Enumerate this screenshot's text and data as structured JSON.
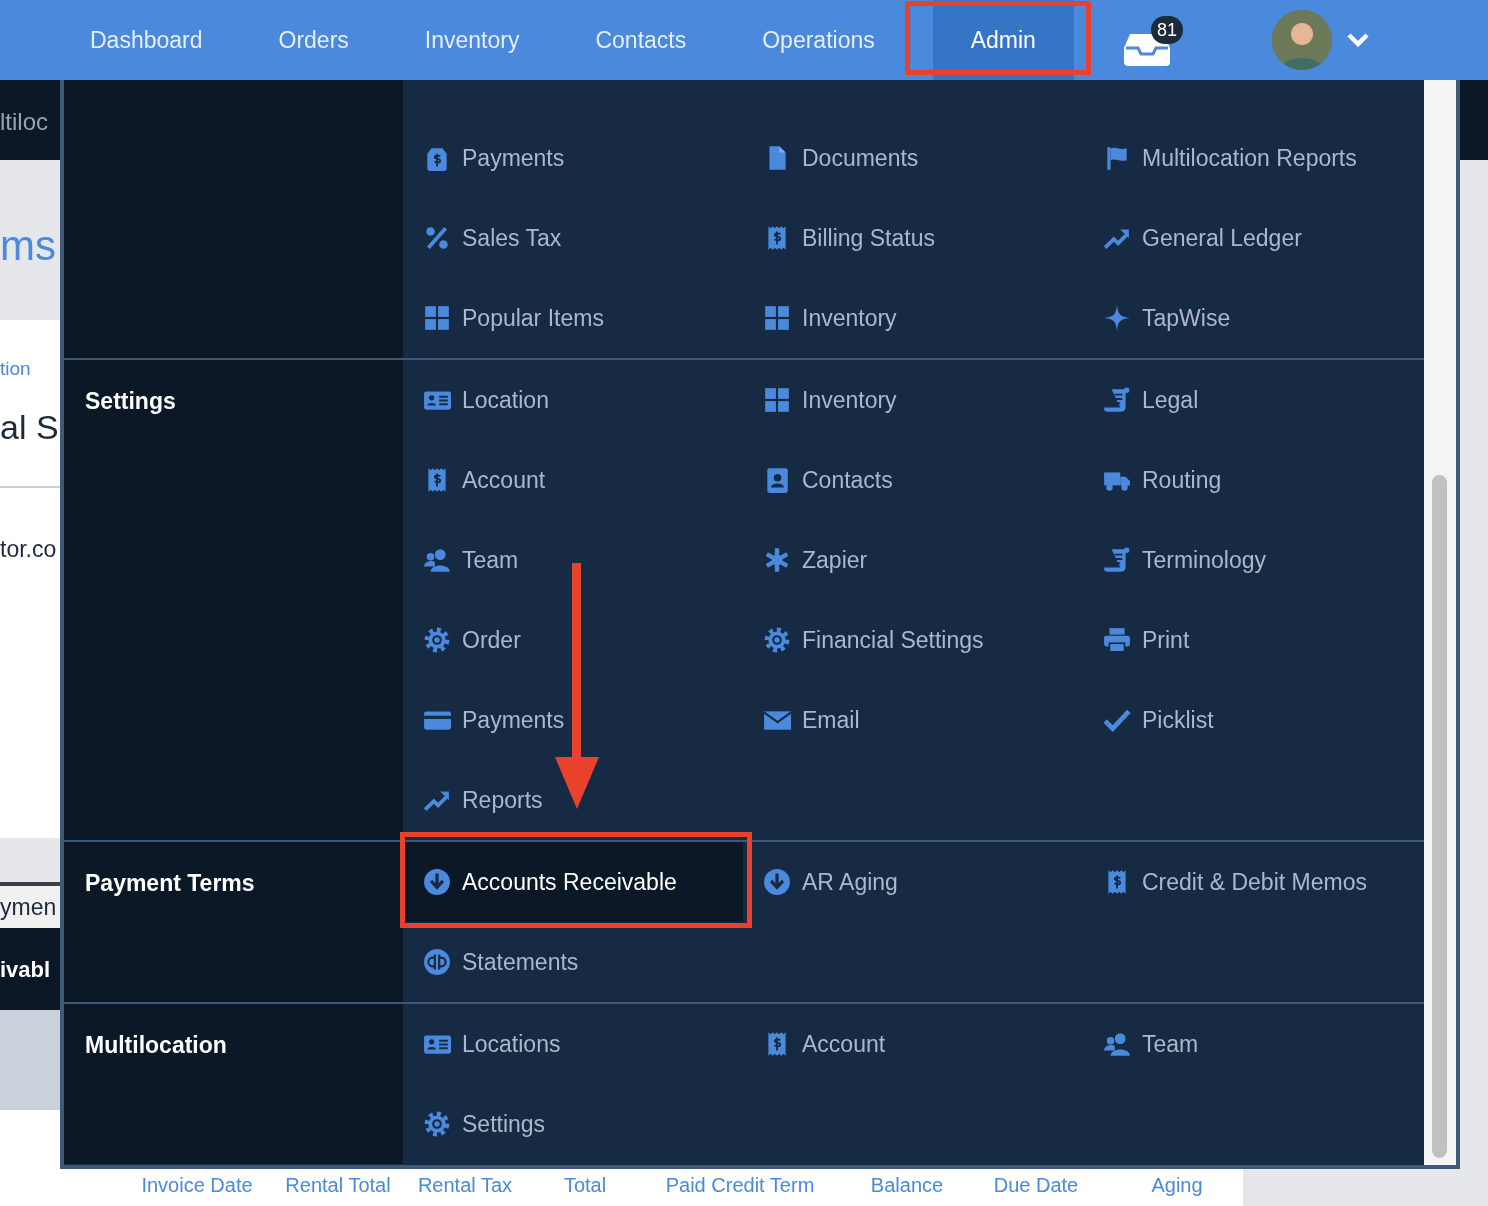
{
  "nav": {
    "items": [
      {
        "label": "Dashboard",
        "selected": false
      },
      {
        "label": "Orders",
        "selected": false
      },
      {
        "label": "Inventory",
        "selected": false
      },
      {
        "label": "Contacts",
        "selected": false
      },
      {
        "label": "Operations",
        "selected": false
      },
      {
        "label": "Admin",
        "selected": true
      }
    ],
    "inbox_badge": "81"
  },
  "background": {
    "breadcrumb": "ltiloc",
    "heading": "ms",
    "link": "tion",
    "title": "al S",
    "email": "tor.co",
    "tab": "ymen",
    "active_tab": "ivabl",
    "columns": [
      "Invoice Date",
      "Rental Total",
      "Rental Tax",
      "Total",
      "Paid Credit Term",
      "Balance",
      "Due Date",
      "Aging"
    ]
  },
  "admin_menu": {
    "sections": [
      {
        "items": [
          {
            "label": "Payments",
            "selected": false
          },
          {
            "label": "Documents",
            "selected": false
          },
          {
            "label": "Multilocation Reports",
            "selected": false
          },
          {
            "label": "Sales Tax",
            "selected": false
          },
          {
            "label": "Billing Status",
            "selected": false
          },
          {
            "label": "General Ledger",
            "selected": false
          },
          {
            "label": "Popular Items",
            "selected": false
          },
          {
            "label": "Inventory",
            "selected": false
          },
          {
            "label": "TapWise",
            "selected": false
          }
        ]
      },
      {
        "title": "Settings",
        "items": [
          {
            "label": "Location",
            "selected": false
          },
          {
            "label": "Inventory",
            "selected": false
          },
          {
            "label": "Legal",
            "selected": false
          },
          {
            "label": "Account",
            "selected": false
          },
          {
            "label": "Contacts",
            "selected": false
          },
          {
            "label": "Routing",
            "selected": false
          },
          {
            "label": "Team",
            "selected": false
          },
          {
            "label": "Zapier",
            "selected": false
          },
          {
            "label": "Terminology",
            "selected": false
          },
          {
            "label": "Order",
            "selected": false
          },
          {
            "label": "Financial Settings",
            "selected": false
          },
          {
            "label": "Print",
            "selected": false
          },
          {
            "label": "Payments",
            "selected": false
          },
          {
            "label": "Email",
            "selected": false
          },
          {
            "label": "Picklist",
            "selected": false
          },
          {
            "label": "Reports",
            "selected": false
          }
        ]
      },
      {
        "title": "Payment Terms",
        "items": [
          {
            "label": "Accounts Receivable",
            "selected": true
          },
          {
            "label": "AR Aging",
            "selected": false
          },
          {
            "label": "Credit & Debit Memos",
            "selected": false
          },
          {
            "label": "Statements",
            "selected": false
          }
        ]
      },
      {
        "title": "Multilocation",
        "items": [
          {
            "label": "Locations",
            "selected": false
          },
          {
            "label": "Account",
            "selected": false
          },
          {
            "label": "Team",
            "selected": false
          },
          {
            "label": "Settings",
            "selected": false
          }
        ]
      }
    ]
  }
}
